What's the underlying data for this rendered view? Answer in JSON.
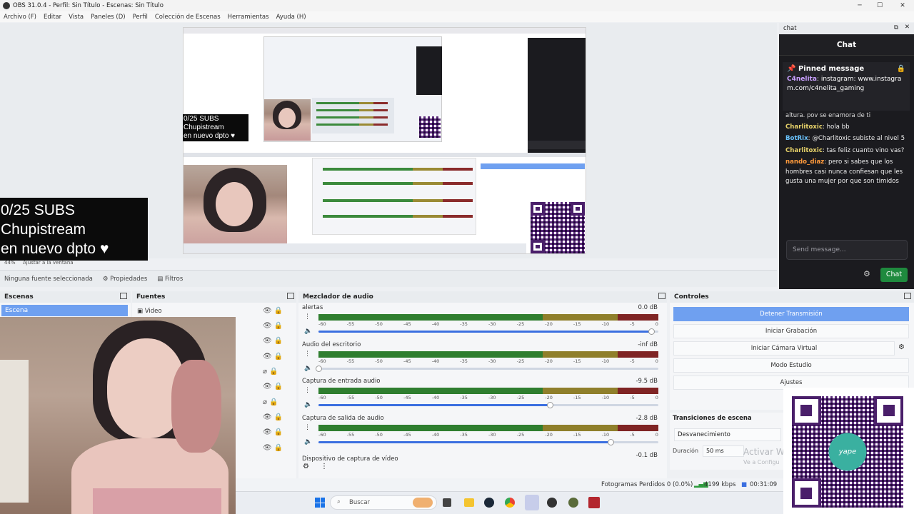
{
  "window": {
    "title": "OBS 31.0.4 - Perfil: Sin Título - Escenas: Sin Título"
  },
  "menu": [
    "Archivo (F)",
    "Editar",
    "Vista",
    "Paneles (D)",
    "Perfil",
    "Colección de Escenas",
    "Herramientas",
    "Ayuda (H)"
  ],
  "overlay": {
    "line1": "0/25 SUBS",
    "line2": "Chupistream",
    "line3": "en nuevo dpto ♥"
  },
  "chat": {
    "dock_title": "chat",
    "header": "Chat",
    "pinned_label": "Pinned message",
    "pinned_user": "C4nelita",
    "pinned_text": "instagram: www.instagram.com/c4nelita_gaming",
    "partial_text": "altura. pov se enamora de ti",
    "messages": [
      {
        "user": "Charlitoxic",
        "text": "hola bb",
        "color": "#e8d36a"
      },
      {
        "user": "BotRix",
        "text": "@Charlitoxic subiste al nivel 5",
        "color": "#6ac4ff"
      },
      {
        "user": "Charlitoxic",
        "text": "tas feliz cuanto vino vas?",
        "color": "#e8d36a"
      },
      {
        "user": "nando_diaz",
        "text": "pero si sabes que los hombres casi nunca confiesan que les gusta una mujer por que son timidos",
        "color": "#ff9a3c"
      }
    ],
    "input_placeholder": "Send message...",
    "send_label": "Chat"
  },
  "source_toolbar": {
    "no_source": "Ninguna fuente seleccionada",
    "properties": "Propiedades",
    "filters": "Filtros"
  },
  "docks": {
    "scenes": "Escenas",
    "sources": "Fuentes",
    "mixer": "Mezclador de audio",
    "controls": "Controles",
    "transitions": "Transiciones de escena"
  },
  "scenes": {
    "selected": "Escena"
  },
  "sources": {
    "first": "Video"
  },
  "mixer": {
    "channels": [
      {
        "name": "alertas",
        "db": "0.0 dB",
        "level": 0.98
      },
      {
        "name": "Audio del escritorio",
        "db": "-inf dB",
        "level": 0.0
      },
      {
        "name": "Captura de entrada audio",
        "db": "-9.5 dB",
        "level": 0.68
      },
      {
        "name": "Captura de salida de audio",
        "db": "-2.8 dB",
        "level": 0.86
      }
    ],
    "partial_channel": "Dispositivo de captura de vídeo",
    "partial_db": "-0.1 dB",
    "ticks": [
      "-60",
      "-55",
      "-50",
      "-45",
      "-40",
      "-35",
      "-30",
      "-25",
      "-20",
      "-15",
      "-10",
      "-5",
      "0"
    ]
  },
  "controls": {
    "stop_stream": "Detener Transmisión",
    "start_record": "Iniciar Grabación",
    "virtual_cam": "Iniciar Cámara Virtual",
    "studio_mode": "Modo Estudio",
    "settings": "Ajustes"
  },
  "transitions": {
    "type": "Desvanecimiento",
    "duration_label": "Duración",
    "duration_value": "50 ms",
    "watermark": "Activar W",
    "watermark2": "Ve a Configu"
  },
  "status": {
    "dropped": "Fotogramas Perdidos 0 (0.0%)",
    "bitrate": "4199 kbps",
    "time": "00:31:09"
  },
  "taskbar": {
    "search_placeholder": "Buscar"
  },
  "preview": {
    "fit_label": "Ajustar a la ventana",
    "zoom": "44%"
  },
  "qr": {
    "brand": "yape"
  }
}
